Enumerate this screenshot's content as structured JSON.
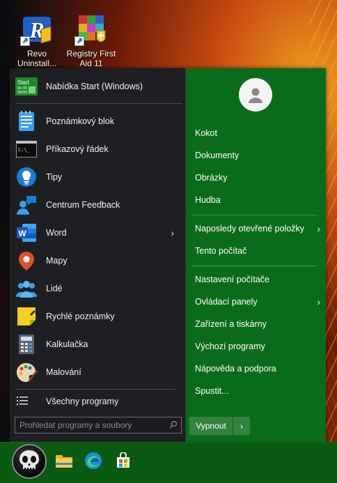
{
  "desktop": {
    "icons": [
      {
        "label": "Revo Uninstall...",
        "icon": "revo-uninstaller-icon"
      },
      {
        "label": "Registry First Aid 11",
        "icon": "registry-first-aid-icon"
      }
    ]
  },
  "start_menu": {
    "apps": [
      {
        "label": "Nabídka Start (Windows)",
        "icon": "start-tiles-icon"
      },
      {
        "label": "Poznámkový blok",
        "icon": "notepad-icon"
      },
      {
        "label": "Příkazový řádek",
        "icon": "cmd-icon"
      },
      {
        "label": "Tipy",
        "icon": "lightbulb-icon"
      },
      {
        "label": "Centrum Feedback",
        "icon": "feedback-hub-icon"
      },
      {
        "label": "Word",
        "icon": "word-icon",
        "has_submenu": true
      },
      {
        "label": "Mapy",
        "icon": "maps-pin-icon"
      },
      {
        "label": "Lidé",
        "icon": "people-icon"
      },
      {
        "label": "Rychlé poznámky",
        "icon": "sticky-notes-icon"
      },
      {
        "label": "Kalkulačka",
        "icon": "calculator-icon"
      },
      {
        "label": "Malování",
        "icon": "paint-palette-icon"
      }
    ],
    "start_tile_text": "Start",
    "cmd_prompt_text": "C:\\_",
    "word_letter": "W",
    "submenu_arrow": "›",
    "all_programs": "Všechny programy",
    "search": {
      "placeholder": "Prohledat programy a soubory",
      "icon": "search-icon"
    },
    "right": {
      "items": [
        {
          "label": "Kokot"
        },
        {
          "label": "Dokumenty"
        },
        {
          "label": "Obrázky"
        },
        {
          "label": "Hudba"
        },
        {
          "label": "Naposledy otevřené položky",
          "has_submenu": true
        },
        {
          "label": "Tento počítač"
        },
        {
          "label": "Nastavení počítače"
        },
        {
          "label": "Ovládací panely",
          "has_submenu": true
        },
        {
          "label": "Zařízení a tiskárny"
        },
        {
          "label": "Výchozí programy"
        },
        {
          "label": "Nápověda a podpora"
        },
        {
          "label": "Spustit..."
        }
      ],
      "power_label": "Vypnout",
      "power_arrow": "›"
    }
  },
  "taskbar": {
    "icons": [
      "start-orb-skull-icon",
      "file-explorer-icon",
      "edge-icon",
      "microsoft-store-icon"
    ]
  },
  "colors": {
    "right_pane_green": "#0b6b1c",
    "left_pane_dark": "#1e1f22",
    "taskbar_green": "#0a5a14"
  }
}
